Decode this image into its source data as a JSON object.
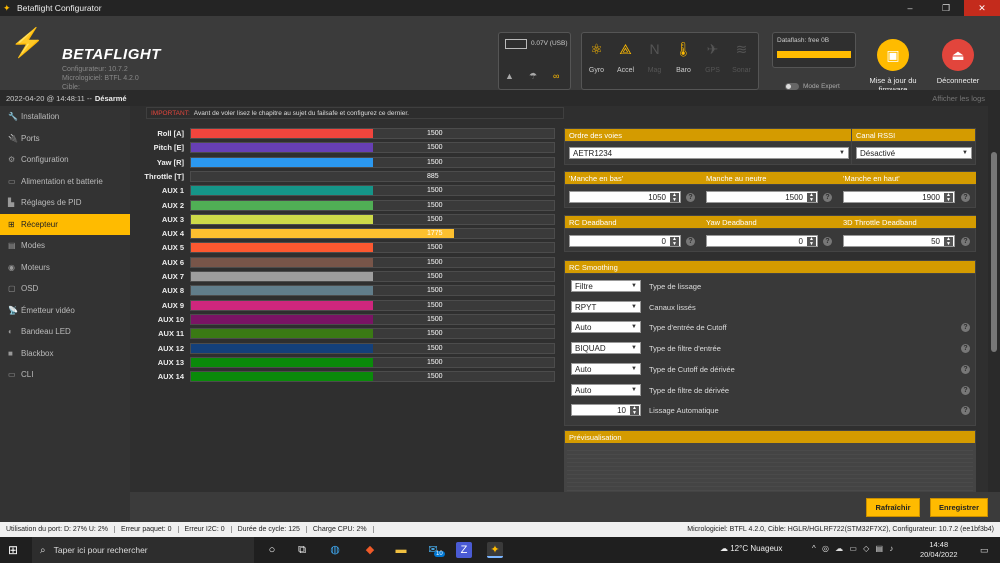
{
  "window": {
    "title": "Betaflight Configurator",
    "min": "–",
    "max": "❐",
    "close": "✕"
  },
  "header": {
    "brand": "BETAFLIGHT",
    "configurator": "Configurateur: 10.7.2",
    "firmware": "Micrologiciel: BTFL 4.2.0",
    "target": "Cible: HGLR/HGLRF722(STM32F7X2)",
    "battery_voltage": "0.07V (USB)",
    "sensors": [
      {
        "label": "Gyro",
        "icon": "gyro-icon",
        "active": true
      },
      {
        "label": "Accel",
        "icon": "accel-icon",
        "active": true
      },
      {
        "label": "Mag",
        "icon": "mag-icon",
        "active": false
      },
      {
        "label": "Baro",
        "icon": "baro-icon",
        "active": true
      },
      {
        "label": "GPS",
        "icon": "gps-icon",
        "active": false
      },
      {
        "label": "Sonar",
        "icon": "sonar-icon",
        "active": false
      }
    ],
    "dataflash": "Dataflash: free 0B",
    "expert_mode": "Mode Expert",
    "update_firmware": "Mise à jour du firmware",
    "disconnect": "Déconnecter"
  },
  "status": {
    "datetime": "2022-04-20 @ 14:48:11",
    "sep": "--",
    "arming": "Désarmé",
    "show_logs": "Afficher les logs"
  },
  "sidebar": {
    "items": [
      {
        "label": "Installation",
        "icon": "wrench-icon",
        "active": false
      },
      {
        "label": "Ports",
        "icon": "plug-icon",
        "active": false
      },
      {
        "label": "Configuration",
        "icon": "gear-icon",
        "active": false
      },
      {
        "label": "Alimentation et batterie",
        "icon": "battery-icon",
        "active": false
      },
      {
        "label": "Réglages de PID",
        "icon": "pid-icon",
        "active": false
      },
      {
        "label": "Récepteur",
        "icon": "receiver-icon",
        "active": true
      },
      {
        "label": "Modes",
        "icon": "modes-icon",
        "active": false
      },
      {
        "label": "Moteurs",
        "icon": "motor-icon",
        "active": false
      },
      {
        "label": "OSD",
        "icon": "osd-icon",
        "active": false
      },
      {
        "label": "Émetteur vidéo",
        "icon": "vtx-icon",
        "active": false
      },
      {
        "label": "Bandeau LED",
        "icon": "led-icon",
        "active": false
      },
      {
        "label": "Blackbox",
        "icon": "blackbox-icon",
        "active": false
      },
      {
        "label": "CLI",
        "icon": "cli-icon",
        "active": false
      }
    ]
  },
  "warning": {
    "prefix": "IMPORTANT:",
    "text": "Avant de voler lisez le chapitre au sujet du failsafe et configurez ce dernier."
  },
  "channels": [
    {
      "label": "Roll [A]",
      "value": 1500,
      "color": "#f1453d"
    },
    {
      "label": "Pitch [E]",
      "value": 1500,
      "color": "#673fb4"
    },
    {
      "label": "Yaw [R]",
      "value": 1500,
      "color": "#2b98f0"
    },
    {
      "label": "Throttle [T]",
      "value": 885,
      "color": "#1fbcd2"
    },
    {
      "label": "AUX 1",
      "value": 1500,
      "color": "#159588"
    },
    {
      "label": "AUX 2",
      "value": 1500,
      "color": "#50ae55"
    },
    {
      "label": "AUX 3",
      "value": 1500,
      "color": "#cdda49"
    },
    {
      "label": "AUX 4",
      "value": 1775,
      "color": "#fdc02f"
    },
    {
      "label": "AUX 5",
      "value": 1500,
      "color": "#fc5830"
    },
    {
      "label": "AUX 6",
      "value": 1500,
      "color": "#785549"
    },
    {
      "label": "AUX 7",
      "value": 1500,
      "color": "#9e9e9e"
    },
    {
      "label": "AUX 8",
      "value": 1500,
      "color": "#617d8a"
    },
    {
      "label": "AUX 9",
      "value": 1500,
      "color": "#cf267d"
    },
    {
      "label": "AUX 10",
      "value": 1500,
      "color": "#7a1464"
    },
    {
      "label": "AUX 11",
      "value": 1500,
      "color": "#3a7a14"
    },
    {
      "label": "AUX 12",
      "value": 1500,
      "color": "#14407a"
    },
    {
      "label": "AUX 13",
      "value": 1500,
      "color": "#0a8a0a"
    },
    {
      "label": "AUX 14",
      "value": 1500,
      "color": "#0a8a0a"
    }
  ],
  "channel_range": [
    885,
    2115
  ],
  "map": {
    "title": "Ordre des voies",
    "value": "AETR1234"
  },
  "rssi": {
    "title": "Canal RSSI",
    "value": "Désactivé"
  },
  "sticks": {
    "low_title": "'Manche en bas'",
    "low": "1050",
    "center_title": "Manche au neutre",
    "center": "1500",
    "high_title": "'Manche en haut'",
    "high": "1900"
  },
  "deadband": {
    "rc_title": "RC Deadband",
    "rc": "0",
    "yaw_title": "Yaw Deadband",
    "yaw": "0",
    "throttle_title": "3D Throttle Deadband",
    "throttle": "50"
  },
  "smoothing": {
    "title": "RC Smoothing",
    "rows": [
      {
        "value": "Filtre",
        "label": "Type de lissage",
        "help": false,
        "kind": "select"
      },
      {
        "value": "RPYT",
        "label": "Canaux lissés",
        "help": false,
        "kind": "select"
      },
      {
        "value": "Auto",
        "label": "Type d'entrée de Cutoff",
        "help": true,
        "kind": "select"
      },
      {
        "value": "BIQUAD",
        "label": "Type de filtre d'entrée",
        "help": true,
        "kind": "select"
      },
      {
        "value": "Auto",
        "label": "Type de Cutoff de dérivée",
        "help": true,
        "kind": "select"
      },
      {
        "value": "Auto",
        "label": "Type de filtre de dérivée",
        "help": true,
        "kind": "select"
      },
      {
        "value": "10",
        "label": "Lissage Automatique",
        "help": true,
        "kind": "number"
      }
    ]
  },
  "preview": {
    "title": "Prévisualisation"
  },
  "buttons": {
    "refresh": "Rafraîchir",
    "save": "Enregistrer"
  },
  "app_status": {
    "port": "Utilisation du port: D: 27% U: 2%",
    "packet": "Erreur paquet: 0",
    "i2c": "Erreur I2C: 0",
    "cycle": "Durée de cycle: 125",
    "cpu": "Charge CPU: 2%",
    "fw": "Micrologiciel: BTFL 4.2.0, Cible: HGLR/HGLRF722(STM32F7X2), Configurateur: 10.7.2 (ee1bf3b4)"
  },
  "taskbar": {
    "search_placeholder": "Taper ici pour rechercher",
    "weather": "12°C  Nuageux",
    "time": "14:48",
    "date": "20/04/2022",
    "badge": "10"
  }
}
